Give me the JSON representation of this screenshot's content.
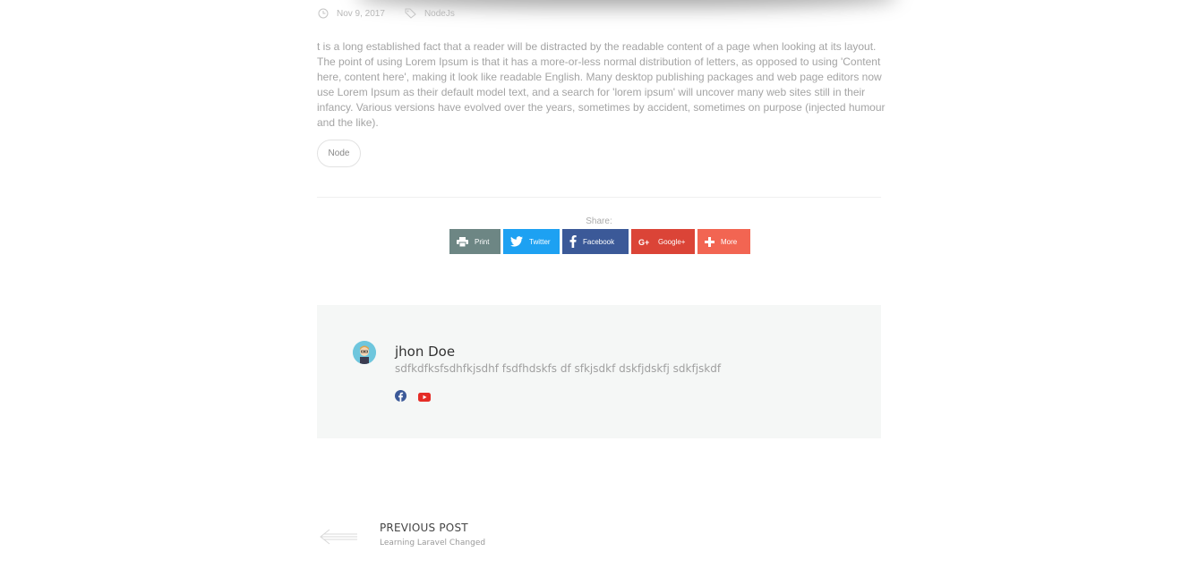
{
  "meta": {
    "date": "Nov 9, 2017",
    "category": "NodeJs"
  },
  "post": {
    "content": "t is a long established fact that a reader will be distracted by the readable content of a page when looking at its layout. The point of using Lorem Ipsum is that it has a more-or-less normal distribution of letters, as opposed to using 'Content here, content here', making it look like readable English. Many desktop publishing packages and web page editors now use Lorem Ipsum as their default model text, and a search for 'lorem ipsum' will uncover many web sites still in their infancy. Various versions have evolved over the years, sometimes by accident, sometimes on purpose (injected humour and the like).",
    "tag": "Node"
  },
  "share": {
    "label": "Share:",
    "buttons": [
      {
        "label": "Print",
        "icon": "printer-icon",
        "color": "#6d8684"
      },
      {
        "label": "Twitter",
        "icon": "twitter-icon",
        "color": "#1da1f2"
      },
      {
        "label": "Facebook",
        "icon": "facebook-icon",
        "color": "#3b5998"
      },
      {
        "label": "Google+",
        "icon": "google-plus-icon",
        "color": "#db4437"
      },
      {
        "label": "More",
        "icon": "plus-icon",
        "color": "#f26552"
      }
    ]
  },
  "author": {
    "name": "jhon Doe",
    "bio": "sdfkdfksfsdhfkjsdhf fsdfhdskfs df sfkjsdkf dskfjdskfj sdkfjskdf",
    "social": [
      {
        "icon": "facebook-icon",
        "color": "#3b5998"
      },
      {
        "icon": "youtube-icon",
        "color": "#e52d27"
      }
    ]
  },
  "navigation": {
    "prev_label": "PREVIOUS POST",
    "prev_title": "Learning Laravel Changed"
  }
}
